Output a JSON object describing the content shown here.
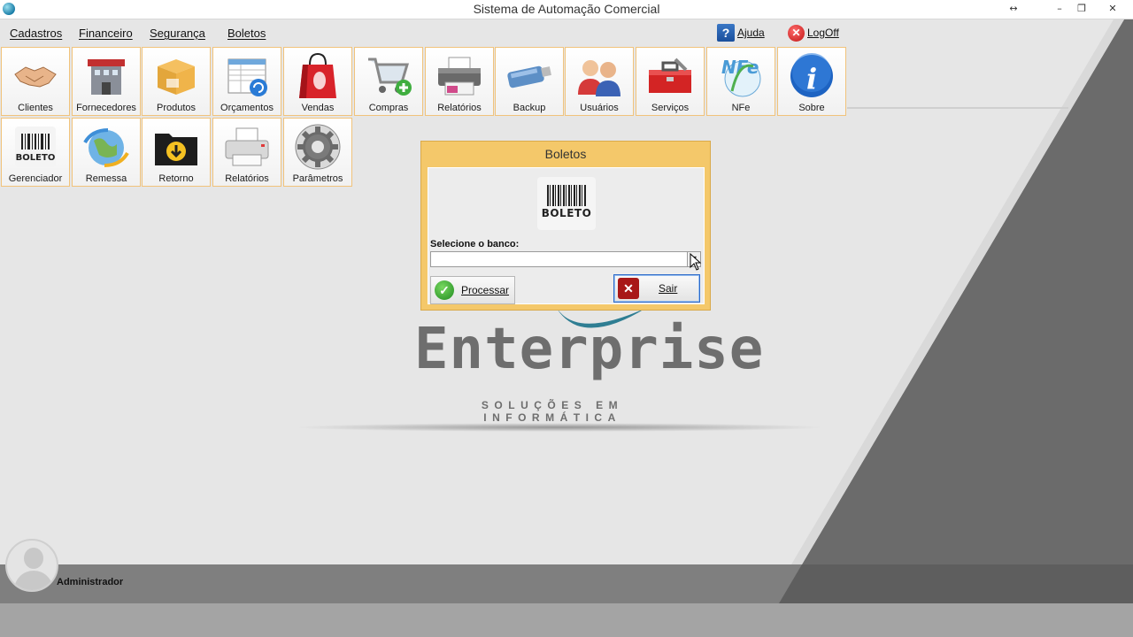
{
  "window": {
    "title": "Sistema de Automação Comercial",
    "controls": {
      "resize": "↔",
      "minimize": "–",
      "restore": "❐",
      "close": "✕"
    }
  },
  "menu": [
    "Cadastros",
    "Financeiro",
    "Segurança",
    "Boletos"
  ],
  "top_links": {
    "help": {
      "label": "Ajuda",
      "icon": "help-book-icon",
      "glyph": "?"
    },
    "logoff": {
      "label": "LogOff",
      "icon": "logoff-icon",
      "glyph": "✕"
    }
  },
  "toolbar_row1": [
    {
      "label": "Clientes",
      "icon": "handshake-icon"
    },
    {
      "label": "Fornecedores",
      "icon": "building-icon"
    },
    {
      "label": "Produtos",
      "icon": "box-icon"
    },
    {
      "label": "Orçamentos",
      "icon": "spreadsheet-icon"
    },
    {
      "label": "Vendas",
      "icon": "shopping-bag-icon"
    },
    {
      "label": "Compras",
      "icon": "cart-icon"
    },
    {
      "label": "Relatórios",
      "icon": "printer-icon"
    },
    {
      "label": "Backup",
      "icon": "usb-drive-icon"
    },
    {
      "label": "Usuários",
      "icon": "users-icon"
    },
    {
      "label": "Serviços",
      "icon": "toolbox-icon"
    },
    {
      "label": "NFe",
      "icon": "nfe-icon"
    },
    {
      "label": "Sobre",
      "icon": "info-icon"
    }
  ],
  "toolbar_row2": [
    {
      "label": "Gerenciador",
      "icon": "barcode-icon",
      "badge": "BOLETO"
    },
    {
      "label": "Remessa",
      "icon": "globe-sync-icon"
    },
    {
      "label": "Retorno",
      "icon": "download-folder-icon"
    },
    {
      "label": "Relatórios",
      "icon": "printer-icon"
    },
    {
      "label": "Parâmetros",
      "icon": "gear-icon"
    }
  ],
  "nfe_badge": "NFe",
  "logo": {
    "name": "Enterprise",
    "tagline": "SOLUÇÕES EM INFORMÁTICA"
  },
  "dialog": {
    "title": "Boletos",
    "image_text": "BOLETO",
    "select_label": "Selecione o banco:",
    "select_value": "",
    "process_label": "Processar",
    "exit_label": "Sair",
    "ok_glyph": "✓",
    "x_glyph": "✕",
    "arrow_glyph": "▼"
  },
  "user": {
    "name": "Administrador"
  },
  "colors": {
    "tile_border": "#f1c37b",
    "dialog_frame": "#f4c86a",
    "background": "#e6e6e6",
    "slash": "#6b6b6b"
  }
}
